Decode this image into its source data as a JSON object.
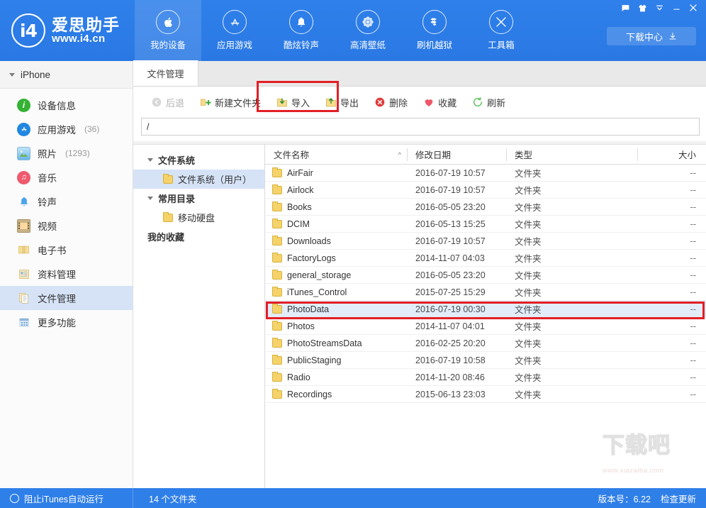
{
  "brand": {
    "logo_text": "i4",
    "name_cn": "爱思助手",
    "url": "www.i4.cn"
  },
  "header": {
    "nav": [
      {
        "label": "我的设备",
        "icon": "apple-icon",
        "active": true
      },
      {
        "label": "应用游戏",
        "icon": "appstore-icon",
        "active": false
      },
      {
        "label": "酷炫铃声",
        "icon": "bell-icon",
        "active": false
      },
      {
        "label": "高清壁纸",
        "icon": "flower-icon",
        "active": false
      },
      {
        "label": "刷机越狱",
        "icon": "dropbox-icon",
        "active": false
      },
      {
        "label": "工具箱",
        "icon": "tools-icon",
        "active": false
      }
    ],
    "window_buttons": [
      {
        "name": "feedback-icon",
        "glyph": "message"
      },
      {
        "name": "skin-icon",
        "glyph": "shirt"
      },
      {
        "name": "minimize-to-tray-icon",
        "glyph": "chevron-down"
      },
      {
        "name": "minimize-icon",
        "glyph": "minus"
      },
      {
        "name": "close-icon",
        "glyph": "close"
      }
    ],
    "download_center_label": "下载中心"
  },
  "sidebar": {
    "device": "iPhone",
    "items": [
      {
        "label": "设备信息",
        "count": "",
        "icon": "info-icon",
        "color": "#34b233",
        "glyph": "i",
        "active": false
      },
      {
        "label": "应用游戏",
        "count": "(36)",
        "icon": "appstore-icon",
        "color": "#1e90e8",
        "glyph": "A",
        "active": false
      },
      {
        "label": "照片",
        "count": "(1293)",
        "icon": "photos-icon",
        "color": "#5cb8e8",
        "glyph": "▲",
        "active": false
      },
      {
        "label": "音乐",
        "count": "",
        "icon": "music-icon",
        "color": "#ef5a6b",
        "glyph": "♪",
        "active": false
      },
      {
        "label": "铃声",
        "count": "",
        "icon": "ringtone-icon",
        "color": "#4da4ea",
        "glyph": "🔔",
        "active": false
      },
      {
        "label": "视频",
        "count": "",
        "icon": "video-icon",
        "color": "#c8b48a",
        "glyph": "▦",
        "active": false
      },
      {
        "label": "电子书",
        "count": "",
        "icon": "ebook-icon",
        "color": "#f2cf77",
        "glyph": "▤",
        "active": false
      },
      {
        "label": "资料管理",
        "count": "",
        "icon": "contacts-icon",
        "color": "#f0dca0",
        "glyph": "▤",
        "active": false
      },
      {
        "label": "文件管理",
        "count": "",
        "icon": "filemanager-icon",
        "color": "#e9dcb2",
        "glyph": "▤",
        "active": true
      },
      {
        "label": "更多功能",
        "count": "",
        "icon": "more-icon",
        "color": "#a9c7e6",
        "glyph": "▦",
        "active": false
      }
    ]
  },
  "content": {
    "tab_label": "文件管理",
    "toolbar": [
      {
        "label": "后退",
        "icon": "back-icon",
        "disabled": true
      },
      {
        "label": "新建文件夹",
        "icon": "new-folder-icon",
        "disabled": false
      },
      {
        "label": "导入",
        "icon": "import-icon",
        "disabled": false
      },
      {
        "label": "导出",
        "icon": "export-icon",
        "disabled": false
      },
      {
        "label": "删除",
        "icon": "delete-icon",
        "disabled": false
      },
      {
        "label": "收藏",
        "icon": "favorite-icon",
        "disabled": false
      },
      {
        "label": "刷新",
        "icon": "refresh-icon",
        "disabled": false
      }
    ],
    "path_value": "/",
    "tree": [
      {
        "type": "group",
        "label": "文件系统"
      },
      {
        "type": "node",
        "label": "文件系统（用户）",
        "selected": true
      },
      {
        "type": "group",
        "label": "常用目录"
      },
      {
        "type": "node",
        "label": "移动硬盘",
        "selected": false
      },
      {
        "type": "plain",
        "label": "我的收藏"
      }
    ],
    "columns": [
      {
        "label": "文件名称",
        "sort": "^"
      },
      {
        "label": "修改日期",
        "sort": ""
      },
      {
        "label": "类型",
        "sort": ""
      },
      {
        "label": "大小",
        "sort": ""
      }
    ],
    "rows": [
      {
        "name": "AirFair",
        "date": "2016-07-19 10:57",
        "type": "文件夹",
        "size": "--",
        "selected": false
      },
      {
        "name": "Airlock",
        "date": "2016-07-19 10:57",
        "type": "文件夹",
        "size": "--",
        "selected": false
      },
      {
        "name": "Books",
        "date": "2016-05-05 23:20",
        "type": "文件夹",
        "size": "--",
        "selected": false
      },
      {
        "name": "DCIM",
        "date": "2016-05-13 15:25",
        "type": "文件夹",
        "size": "--",
        "selected": false
      },
      {
        "name": "Downloads",
        "date": "2016-07-19 10:57",
        "type": "文件夹",
        "size": "--",
        "selected": false
      },
      {
        "name": "FactoryLogs",
        "date": "2014-11-07 04:03",
        "type": "文件夹",
        "size": "--",
        "selected": false
      },
      {
        "name": "general_storage",
        "date": "2016-05-05 23:20",
        "type": "文件夹",
        "size": "--",
        "selected": false
      },
      {
        "name": "iTunes_Control",
        "date": "2015-07-25 15:29",
        "type": "文件夹",
        "size": "--",
        "selected": false
      },
      {
        "name": "PhotoData",
        "date": "2016-07-19 00:30",
        "type": "文件夹",
        "size": "--",
        "selected": true
      },
      {
        "name": "Photos",
        "date": "2014-11-07 04:01",
        "type": "文件夹",
        "size": "--",
        "selected": false
      },
      {
        "name": "PhotoStreamsData",
        "date": "2016-02-25 20:20",
        "type": "文件夹",
        "size": "--",
        "selected": false
      },
      {
        "name": "PublicStaging",
        "date": "2016-07-19 10:58",
        "type": "文件夹",
        "size": "--",
        "selected": false
      },
      {
        "name": "Radio",
        "date": "2014-11-20 08:46",
        "type": "文件夹",
        "size": "--",
        "selected": false
      },
      {
        "name": "Recordings",
        "date": "2015-06-13 23:03",
        "type": "文件夹",
        "size": "--",
        "selected": false
      }
    ],
    "watermark_top": "下载吧",
    "watermark_bottom": "www.xiazaiba.com"
  },
  "statusbar": {
    "itunes_toggle": "阻止iTunes自动运行",
    "count_text": "14 个文件夹",
    "version": "版本号：6.22",
    "check_update": "检查更新"
  },
  "colors": {
    "brand_blue": "#2f7fe8",
    "highlight_red": "#e21f26",
    "selection_blue": "#d6e3f7"
  }
}
